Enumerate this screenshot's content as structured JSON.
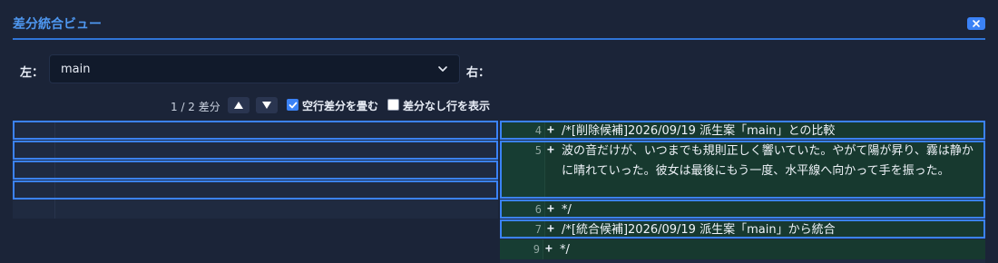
{
  "window": {
    "title": "差分統合ビュー",
    "close_icon": "close-icon",
    "accent": "#3b82f6"
  },
  "selectors": {
    "left_label": "左：",
    "left_value": "main",
    "right_label": "右："
  },
  "toolbar": {
    "counter": "1 / 2 差分",
    "prev_icon": "arrow-up-icon",
    "next_icon": "arrow-down-icon",
    "collapse_blank_label": "空行差分を畳む",
    "collapse_blank_checked": true,
    "show_same_label": "差分なし行を表示",
    "show_same_checked": false
  },
  "right_lines": [
    {
      "line": "4",
      "mark": "+",
      "text": "/*[削除候補]2026/09/19 派生案「main」との比較"
    },
    {
      "line": "5",
      "mark": "+",
      "text": "波の音だけが、いつまでも規則正しく響いていた。やがて陽が昇り、霧は静かに晴れていった。彼女は最後にもう一度、水平線へ向かって手を振った。"
    },
    {
      "line": "6",
      "mark": "+",
      "text": "*/"
    },
    {
      "line": "7",
      "mark": "+",
      "text": "/*[統合候補]2026/09/19 派生案「main」から統合"
    },
    {
      "line": "9",
      "mark": "+",
      "text": "*/"
    }
  ]
}
